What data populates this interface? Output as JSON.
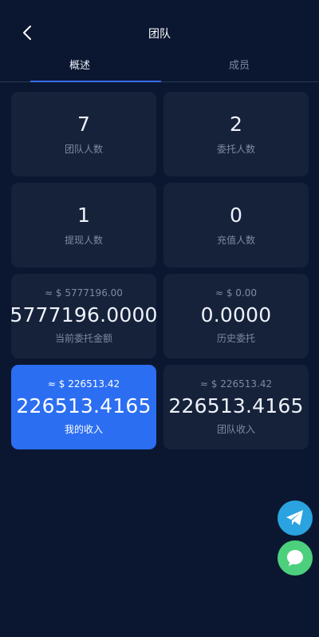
{
  "header": {
    "title": "团队",
    "back_icon": "chevron-left-icon"
  },
  "tabs": [
    {
      "label": "概述",
      "active": true
    },
    {
      "label": "成员",
      "active": false
    }
  ],
  "stats": {
    "team_count": {
      "value": "7",
      "label": "团队人数"
    },
    "delegate_count": {
      "value": "2",
      "label": "委托人数"
    },
    "withdraw_count": {
      "value": "1",
      "label": "提现人数"
    },
    "recharge_count": {
      "value": "0",
      "label": "充值人数"
    },
    "current_delegation": {
      "approx": "≈ $ 5777196.00",
      "amount": "5777196.0000",
      "label": "当前委托金额"
    },
    "history_delegation": {
      "approx": "≈ $ 0.00",
      "amount": "0.0000",
      "label": "历史委托"
    },
    "my_income": {
      "approx": "≈ $ 226513.42",
      "amount": "226513.4165",
      "label": "我的收入"
    },
    "team_income": {
      "approx": "≈ $ 226513.42",
      "amount": "226513.4165",
      "label": "团队收入"
    }
  },
  "colors": {
    "background": "#0b1730",
    "card": "#16223a",
    "accent": "#2b6ef2",
    "telegram": "#2aa3e0",
    "chat": "#4cd07d"
  },
  "fabs": [
    {
      "icon": "telegram-icon"
    },
    {
      "icon": "chat-bubble-icon"
    }
  ]
}
